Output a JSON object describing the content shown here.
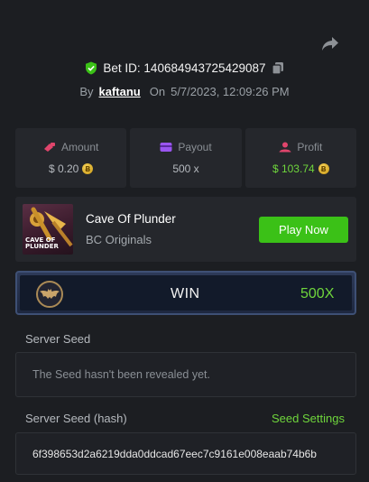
{
  "bet": {
    "id_label": "Bet ID: 140684943725429087",
    "by_label": "By",
    "username": "kaftanu",
    "on_label": "On",
    "datetime": "5/7/2023, 12:09:26 PM"
  },
  "stats": [
    {
      "title": "Amount",
      "value": "$ 0.20",
      "icon": "coins-icon"
    },
    {
      "title": "Payout",
      "value": "500 x",
      "icon": "wallet-icon"
    },
    {
      "title": "Profit",
      "value": "$ 103.74",
      "icon": "profit-icon"
    }
  ],
  "game": {
    "thumb_label": "CAVE OF PLUNDER",
    "name": "Cave Of Plunder",
    "provider": "BC Originals",
    "play_label": "Play Now"
  },
  "result": {
    "status": "WIN",
    "multiplier": "500X"
  },
  "server_seed": {
    "label": "Server Seed",
    "message": "The Seed hasn't been revealed yet."
  },
  "server_seed_hash": {
    "label": "Server Seed (hash)",
    "settings_label": "Seed Settings",
    "value": "6f398653d2a6219dda0ddcad67eec7c9161e008eaab74b6b"
  },
  "colors": {
    "background": "#1c1e22",
    "panel": "#25272c",
    "accent_green": "#3bc117",
    "profit_green": "#6fd63c"
  }
}
